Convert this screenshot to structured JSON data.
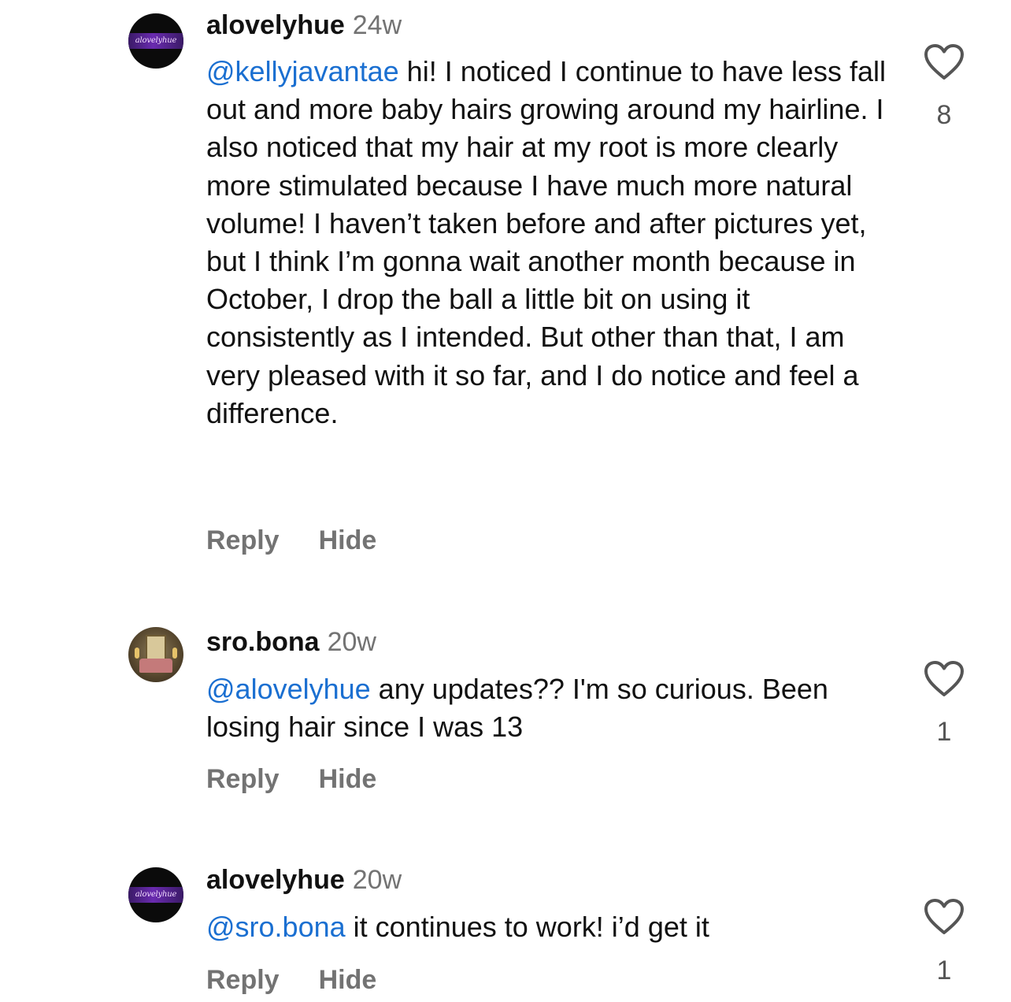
{
  "comments": [
    {
      "username": "alovelyhue",
      "time": "24w",
      "avatar_text": "alovelyhue",
      "mention": "@kellyjavantae",
      "text": " hi! I noticed I continue to have less fall out and more baby hairs growing around my hairline. I also noticed that my hair at my root is more clearly more stimulated because I have much more natural volume! I haven’t taken before and after pictures yet, but I think I’m gonna wait another month because in October, I drop the ball a little bit on using it consistently as I intended. But other than that, I am very pleased with it so far, and I do notice and feel a difference.",
      "reply_label": "Reply",
      "hide_label": "Hide",
      "likes": "8",
      "heart_icon": "heart-outline-icon"
    },
    {
      "username": "sro.bona",
      "time": "20w",
      "mention": "@alovelyhue",
      "text": " any updates?? I'm so curious. Been losing hair since I was 13",
      "reply_label": "Reply",
      "hide_label": "Hide",
      "likes": "1",
      "heart_icon": "heart-outline-icon"
    },
    {
      "username": "alovelyhue",
      "time": "20w",
      "avatar_text": "alovelyhue",
      "mention": "@sro.bona",
      "text": " it continues to work! i’d get it",
      "reply_label": "Reply",
      "hide_label": "Hide",
      "likes": "1",
      "heart_icon": "heart-outline-icon"
    }
  ],
  "colors": {
    "mention": "#1a6fd1",
    "muted": "#737373",
    "text": "#111111"
  }
}
